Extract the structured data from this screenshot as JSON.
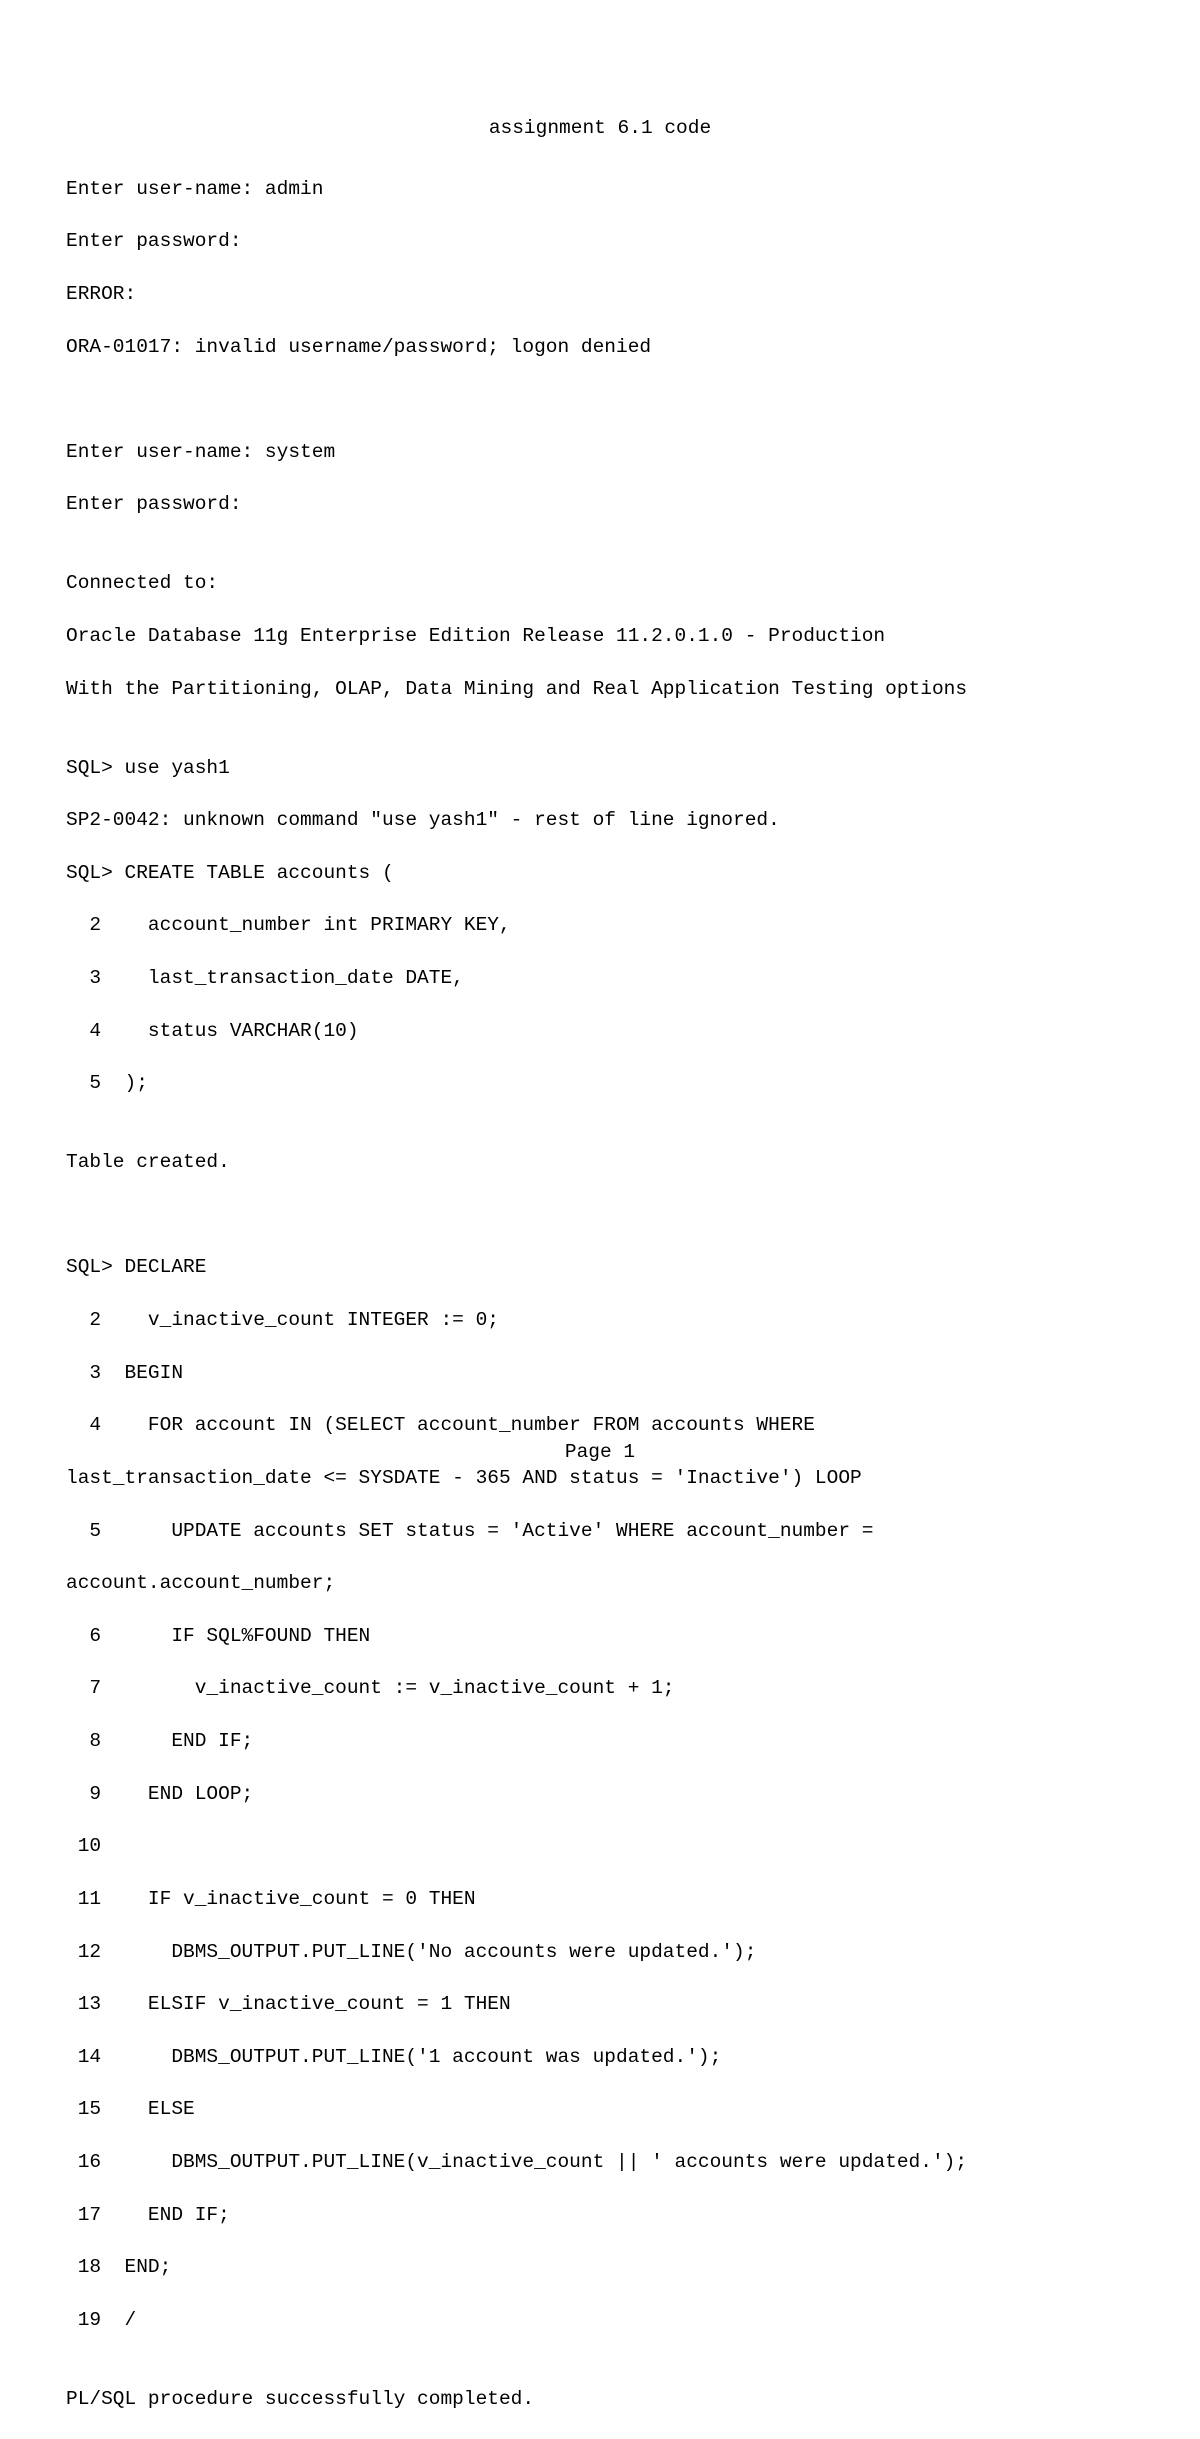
{
  "title": "assignment 6.1 code",
  "lines": {
    "l1": "Enter user-name: admin",
    "l2": "Enter password:",
    "l3": "ERROR:",
    "l4": "ORA-01017: invalid username/password; logon denied",
    "l5": "",
    "l6": "",
    "l7": "Enter user-name: system",
    "l8": "Enter password:",
    "l9": "",
    "l10": "Connected to:",
    "l11": "Oracle Database 11g Enterprise Edition Release 11.2.0.1.0 - Production",
    "l12": "With the Partitioning, OLAP, Data Mining and Real Application Testing options",
    "l13": "",
    "l14": "SQL> use yash1",
    "l15": "SP2-0042: unknown command \"use yash1\" - rest of line ignored.",
    "l16": "SQL> CREATE TABLE accounts (",
    "l17": "  2    account_number int PRIMARY KEY,",
    "l18": "  3    last_transaction_date DATE,",
    "l19": "  4    status VARCHAR(10)",
    "l20": "  5  );",
    "l21": "",
    "l22": "Table created.",
    "l23": "",
    "l24": "",
    "l25": "SQL> DECLARE",
    "l26": "  2    v_inactive_count INTEGER := 0;",
    "l27": "  3  BEGIN",
    "l28": "  4    FOR account IN (SELECT account_number FROM accounts WHERE ",
    "l29": "last_transaction_date <= SYSDATE - 365 AND status = 'Inactive') LOOP",
    "l30": "  5      UPDATE accounts SET status = 'Active' WHERE account_number = ",
    "l31": "account.account_number;",
    "l32": "  6      IF SQL%FOUND THEN",
    "l33": "  7        v_inactive_count := v_inactive_count + 1;",
    "l34": "  8      END IF;",
    "l35": "  9    END LOOP;",
    "l36": " 10  ",
    "l37": " 11    IF v_inactive_count = 0 THEN",
    "l38": " 12      DBMS_OUTPUT.PUT_LINE('No accounts were updated.');",
    "l39": " 13    ELSIF v_inactive_count = 1 THEN",
    "l40": " 14      DBMS_OUTPUT.PUT_LINE('1 account was updated.');",
    "l41": " 15    ELSE",
    "l42": " 16      DBMS_OUTPUT.PUT_LINE(v_inactive_count || ' accounts were updated.');",
    "l43": " 17    END IF;",
    "l44": " 18  END;",
    "l45": " 19  /",
    "l46": "",
    "l47": "PL/SQL procedure successfully completed."
  },
  "page_number": "Page 1"
}
